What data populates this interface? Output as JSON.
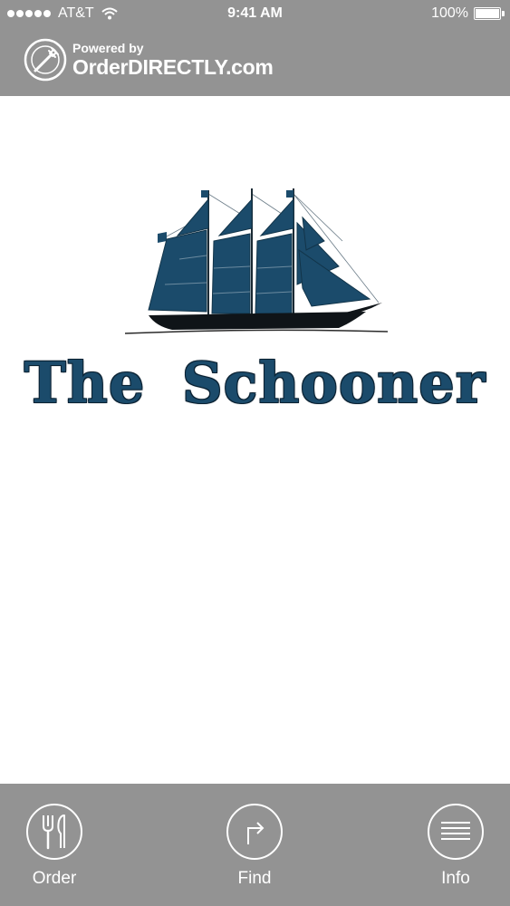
{
  "status_bar": {
    "carrier": "AT&T",
    "time": "9:41 AM",
    "battery_text": "100%",
    "battery_level": 1.0
  },
  "brand": {
    "powered_by": "Powered by",
    "name": "OrderDIRECTLY.com",
    "icon": "fork-plate-icon"
  },
  "restaurant": {
    "name": "The Schooner",
    "logo_icon": "schooner-ship-icon",
    "brand_color": "#1b4b6b"
  },
  "tabs": [
    {
      "label": "Order",
      "icon": "fork-knife-icon"
    },
    {
      "label": "Find",
      "icon": "directions-arrow-icon"
    },
    {
      "label": "Info",
      "icon": "text-lines-icon"
    }
  ],
  "colors": {
    "bar_background": "#939393",
    "foreground": "#ffffff"
  }
}
